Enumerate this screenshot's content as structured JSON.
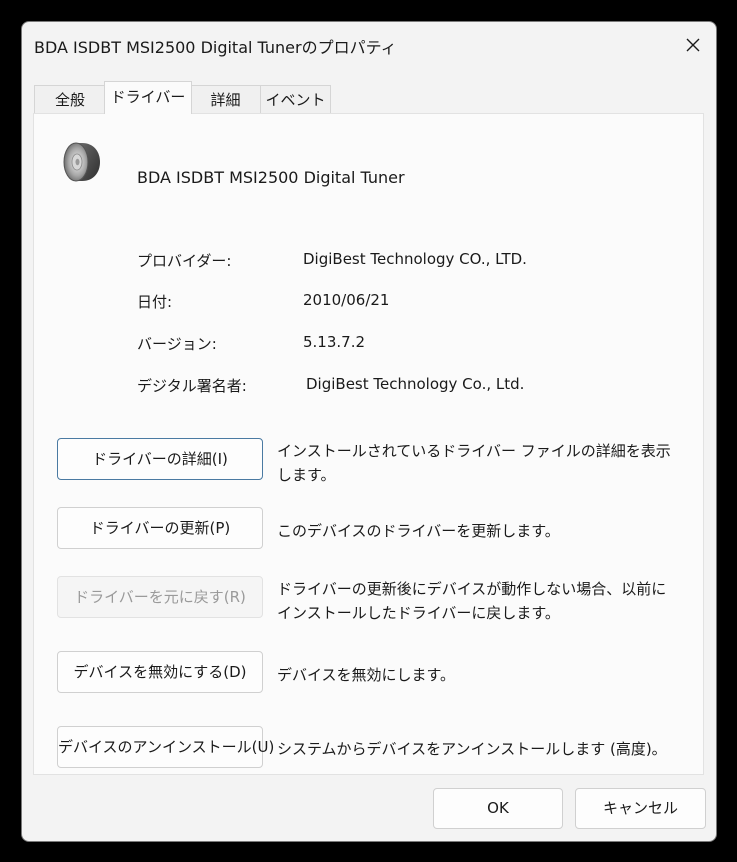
{
  "window": {
    "title": "BDA ISDBT MSI2500 Digital Tunerのプロパティ"
  },
  "tabs": [
    {
      "label": "全般"
    },
    {
      "label": "ドライバー"
    },
    {
      "label": "詳細"
    },
    {
      "label": "イベント"
    }
  ],
  "device": {
    "name": "BDA ISDBT MSI2500 Digital Tuner",
    "icon": "speaker-icon"
  },
  "info": {
    "provider_label": "プロバイダー:",
    "provider_value": "DigiBest Technology CO., LTD.",
    "date_label": "日付:",
    "date_value": "2010/06/21",
    "version_label": "バージョン:",
    "version_value": "5.13.7.2",
    "signer_label": "デジタル署名者:",
    "signer_value": "DigiBest Technology Co., Ltd."
  },
  "actions": {
    "details_button": "ドライバーの詳細(I)",
    "details_desc": "インストールされているドライバー ファイルの詳細を表示します。",
    "update_button": "ドライバーの更新(P)",
    "update_desc": "このデバイスのドライバーを更新します。",
    "rollback_button": "ドライバーを元に戻す(R)",
    "rollback_desc": "ドライバーの更新後にデバイスが動作しない場合、以前にインストールしたドライバーに戻します。",
    "disable_button": "デバイスを無効にする(D)",
    "disable_desc": "デバイスを無効にします。",
    "uninstall_button": "デバイスのアンインストール(U)",
    "uninstall_desc": "システムからデバイスをアンインストールします (高度)。"
  },
  "footer": {
    "ok": "OK",
    "cancel": "キャンセル"
  }
}
